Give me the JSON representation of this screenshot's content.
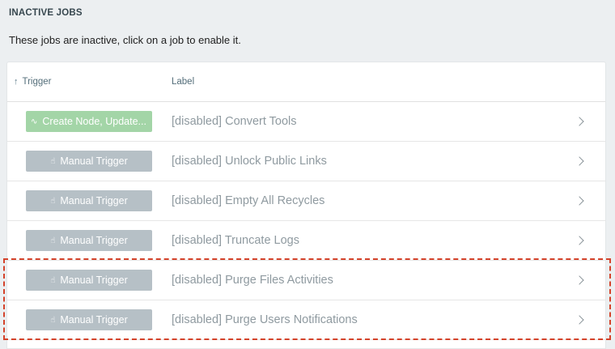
{
  "section": {
    "title": "INACTIVE JOBS",
    "description": "These jobs are inactive, click on a job to enable it."
  },
  "table": {
    "headers": {
      "trigger": "Trigger",
      "label": "Label",
      "sort_icon": "arrow-up-icon"
    },
    "rows": [
      {
        "trigger": "Create Node, Update...",
        "trigger_icon": "pulse-icon",
        "trigger_type": "event",
        "label": "[disabled] Convert Tools"
      },
      {
        "trigger": "Manual Trigger",
        "trigger_icon": "hand-pointer-icon",
        "trigger_type": "manual",
        "label": "[disabled] Unlock Public Links"
      },
      {
        "trigger": "Manual Trigger",
        "trigger_icon": "hand-pointer-icon",
        "trigger_type": "manual",
        "label": "[disabled] Empty All Recycles"
      },
      {
        "trigger": "Manual Trigger",
        "trigger_icon": "hand-pointer-icon",
        "trigger_type": "manual",
        "label": "[disabled] Truncate Logs"
      },
      {
        "trigger": "Manual Trigger",
        "trigger_icon": "hand-pointer-icon",
        "trigger_type": "manual",
        "label": "[disabled] Purge Files Activities"
      },
      {
        "trigger": "Manual Trigger",
        "trigger_icon": "hand-pointer-icon",
        "trigger_type": "manual",
        "label": "[disabled] Purge Users Notifications"
      }
    ]
  },
  "colors": {
    "page_bg": "#eceff1",
    "manual_chip": "#b6c0c6",
    "event_chip": "#a3d5a7",
    "highlight_border": "#d4432b"
  }
}
